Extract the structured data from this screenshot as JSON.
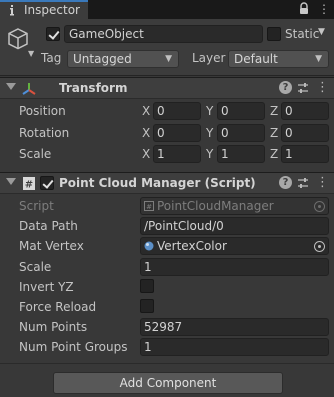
{
  "window": {
    "tab_label": "Inspector",
    "tab_icon": "info-icon",
    "lock_icon": "lock-icon",
    "menu_icon": "kebab-menu-icon",
    "accent_color": "#3a79bb"
  },
  "gameobject": {
    "active": true,
    "name": "GameObject",
    "static_label": "Static",
    "static_checked": false,
    "tag_label": "Tag",
    "tag_value": "Untagged",
    "layer_label": "Layer",
    "layer_value": "Default"
  },
  "transform": {
    "title": "Transform",
    "rows": [
      {
        "label": "Position",
        "x": "0",
        "y": "0",
        "z": "0"
      },
      {
        "label": "Rotation",
        "x": "0",
        "y": "0",
        "z": "0"
      },
      {
        "label": "Scale",
        "x": "1",
        "y": "1",
        "z": "1"
      }
    ],
    "axes": {
      "x": "X",
      "y": "Y",
      "z": "Z"
    }
  },
  "script_component": {
    "title": "Point Cloud Manager (Script)",
    "enabled": true,
    "script_label": "Script",
    "script_value": "PointCloudManager",
    "fields": {
      "data_path_label": "Data Path",
      "data_path_value": "/PointCloud/0",
      "mat_vertex_label": "Mat Vertex",
      "mat_vertex_value": "VertexColor",
      "scale_label": "Scale",
      "scale_value": "1",
      "invert_yz_label": "Invert YZ",
      "invert_yz_checked": false,
      "force_reload_label": "Force Reload",
      "force_reload_checked": false,
      "num_points_label": "Num Points",
      "num_points_value": "52987",
      "num_point_groups_label": "Num Point Groups",
      "num_point_groups_value": "1"
    }
  },
  "footer": {
    "add_component_label": "Add Component"
  }
}
